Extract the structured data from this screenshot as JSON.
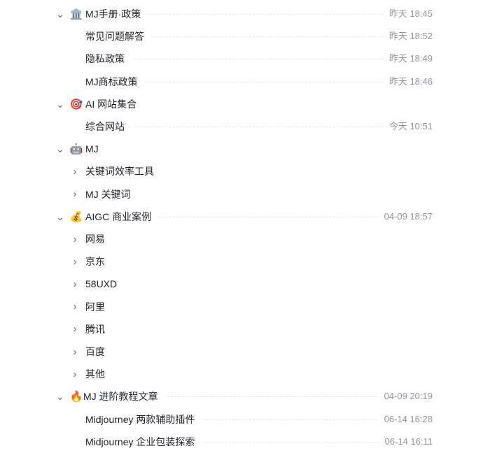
{
  "tree": {
    "rows": [
      {
        "level": 0,
        "expand": "down",
        "emoji": "🏛️",
        "icon": "bank-building-icon",
        "title": "MJ手册·政策",
        "time": "昨天 18:45"
      },
      {
        "level": 1,
        "expand": "none",
        "emoji": "",
        "icon": "",
        "title": "常见问题解答",
        "time": "昨天 18:52"
      },
      {
        "level": 1,
        "expand": "none",
        "emoji": "",
        "icon": "",
        "title": "隐私政策",
        "time": "昨天 18:49"
      },
      {
        "level": 1,
        "expand": "none",
        "emoji": "",
        "icon": "",
        "title": "MJ商标政策",
        "time": "昨天 18:46"
      },
      {
        "level": 0,
        "expand": "down",
        "emoji": "🎯",
        "icon": "target-icon",
        "title": "AI 网站集合",
        "time": ""
      },
      {
        "level": 1,
        "expand": "none",
        "emoji": "",
        "icon": "",
        "title": "综合网站",
        "time": "今天 10:51"
      },
      {
        "level": 0,
        "expand": "down",
        "emoji": "🤖",
        "icon": "robot-icon",
        "title": "MJ",
        "time": ""
      },
      {
        "level": 1,
        "expand": "right",
        "emoji": "",
        "icon": "",
        "title": "关键词效率工具",
        "time": ""
      },
      {
        "level": 1,
        "expand": "right",
        "emoji": "",
        "icon": "",
        "title": "MJ 关键词",
        "time": ""
      },
      {
        "level": 0,
        "expand": "down",
        "emoji": "💰",
        "icon": "money-bag-icon",
        "title": "AIGC 商业案例",
        "time": "04-09 18:57"
      },
      {
        "level": 1,
        "expand": "right",
        "emoji": "",
        "icon": "",
        "title": "网易",
        "time": ""
      },
      {
        "level": 1,
        "expand": "right",
        "emoji": "",
        "icon": "",
        "title": "京东",
        "time": ""
      },
      {
        "level": 1,
        "expand": "right",
        "emoji": "",
        "icon": "",
        "title": "58UXD",
        "time": ""
      },
      {
        "level": 1,
        "expand": "right",
        "emoji": "",
        "icon": "",
        "title": "阿里",
        "time": ""
      },
      {
        "level": 1,
        "expand": "right",
        "emoji": "",
        "icon": "",
        "title": "腾讯",
        "time": ""
      },
      {
        "level": 1,
        "expand": "right",
        "emoji": "",
        "icon": "",
        "title": "百度",
        "time": ""
      },
      {
        "level": 1,
        "expand": "right",
        "emoji": "",
        "icon": "",
        "title": "其他",
        "time": ""
      },
      {
        "level": 0,
        "expand": "down",
        "emoji": "🔥",
        "icon": "fire-icon",
        "title": "MJ 进阶教程文章",
        "time": "04-09 20:19"
      },
      {
        "level": 1,
        "expand": "none",
        "emoji": "",
        "icon": "",
        "title": "Midjourney 两款辅助插件",
        "time": "06-14 16:28"
      },
      {
        "level": 1,
        "expand": "none",
        "emoji": "",
        "icon": "",
        "title": "Midjourney 企业包装探索",
        "time": "06-14 16:11"
      }
    ]
  }
}
